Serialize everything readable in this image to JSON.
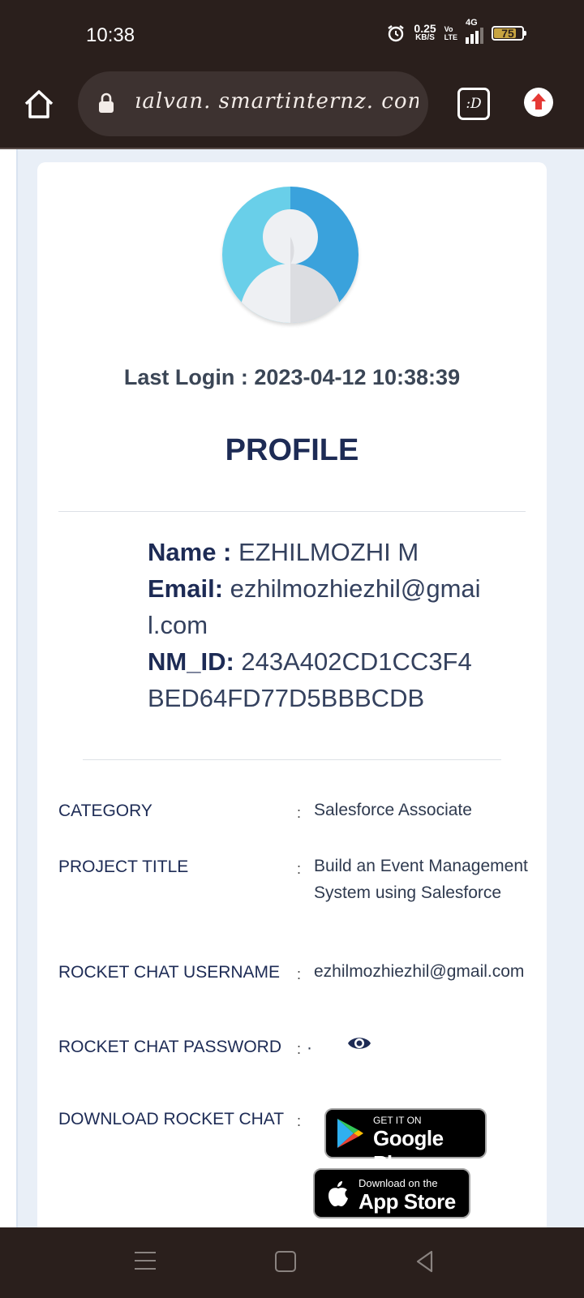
{
  "status_bar": {
    "time": "10:38",
    "net_speed_value": "0.25",
    "net_speed_unit": "KB/S",
    "volte_top": "Vo",
    "volte_bottom": "LTE",
    "network_type": "4G",
    "battery_level": "75"
  },
  "browser": {
    "url": "ıalvan. smartinternz. com",
    "tabs_label": ":D"
  },
  "profile": {
    "last_login": "Last Login : 2023-04-12 10:38:39",
    "title": "PROFILE",
    "name_label": "Name :",
    "name_value": "EZHILMOZHI M",
    "email_label": "Email:",
    "email_value": "ezhilmozhiezhil@gmail.com",
    "nmid_label": "NM_ID:",
    "nmid_value": "243A402CD1CC3F4BED64FD77D5BBBCDB"
  },
  "details": [
    {
      "label": "CATEGORY",
      "value": "Salesforce Associate"
    },
    {
      "label": "PROJECT TITLE",
      "value": "Build an Event Management System using Salesforce"
    },
    {
      "label": "ROCKET CHAT USERNAME",
      "value": "ezhilmozhiezhil@gmail.com"
    },
    {
      "label": "ROCKET CHAT PASSWORD",
      "value": "·"
    },
    {
      "label": "DOWNLOAD ROCKET CHAT",
      "value": ""
    }
  ],
  "store_badges": {
    "google_play_small": "GET IT ON",
    "google_play_big": "Google Play",
    "app_store_small": "Download on the",
    "app_store_big": "App Store"
  },
  "colors": {
    "heading": "#1d2b55",
    "chrome": "#2a1f1c",
    "page_bg": "#e9eff7"
  }
}
